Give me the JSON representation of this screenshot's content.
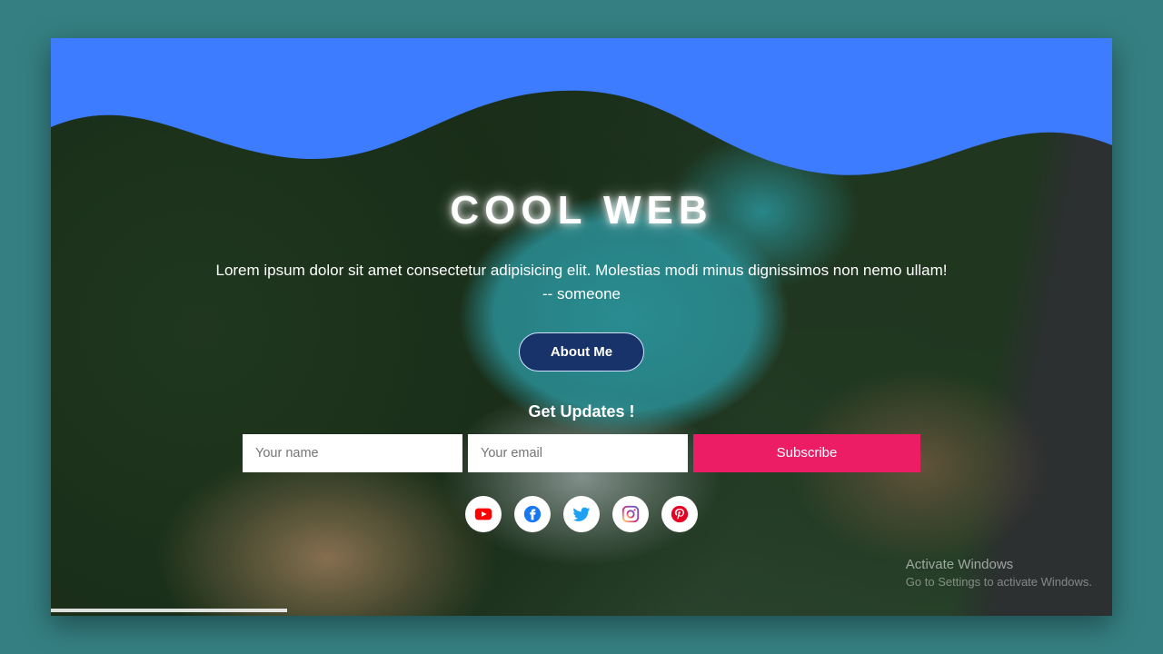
{
  "hero": {
    "title": "COOL WEB",
    "tagline_line1": "Lorem ipsum dolor sit amet consectetur adipisicing elit. Molestias modi minus dignissimos non nemo ullam!",
    "tagline_line2": "-- someone",
    "about_label": "About Me"
  },
  "subscribe": {
    "heading": "Get Updates !",
    "name_placeholder": "Your name",
    "email_placeholder": "Your email",
    "button_label": "Subscribe"
  },
  "socials": {
    "youtube": "youtube-icon",
    "facebook": "facebook-icon",
    "twitter": "twitter-icon",
    "instagram": "instagram-icon",
    "pinterest": "pinterest-icon"
  },
  "watermark": {
    "title": "Activate Windows",
    "subtitle": "Go to Settings to activate Windows."
  },
  "colors": {
    "wave": "#3d7bff",
    "accent_button": "#17336a",
    "subscribe": "#ec1d64",
    "page_bg": "#357f82"
  }
}
